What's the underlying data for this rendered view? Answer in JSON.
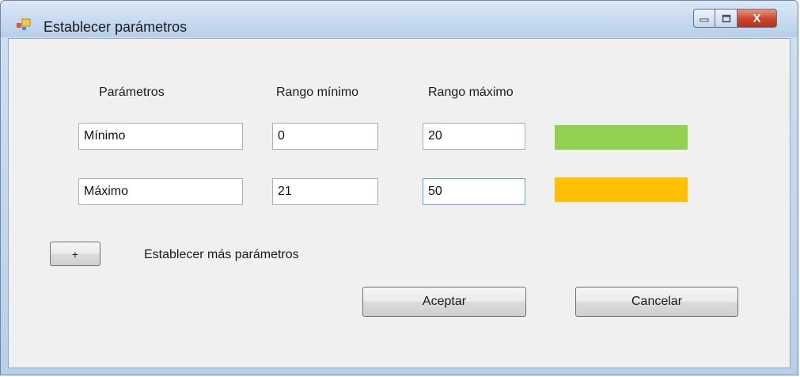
{
  "window": {
    "title": "Establecer parámetros"
  },
  "columns": {
    "parametros": "Parámetros",
    "rango_minimo": "Rango mínimo",
    "rango_maximo": "Rango máximo"
  },
  "rows": [
    {
      "name": "Mínimo",
      "min": "0",
      "max": "20",
      "color": "#92d050"
    },
    {
      "name": "Máximo",
      "min": "21",
      "max": "50",
      "color": "#ffc000"
    }
  ],
  "add_button": {
    "label": "+"
  },
  "add_label": "Establecer más parámetros",
  "buttons": {
    "accept": "Aceptar",
    "cancel": "Cancelar"
  },
  "controls": {
    "close": "X"
  }
}
